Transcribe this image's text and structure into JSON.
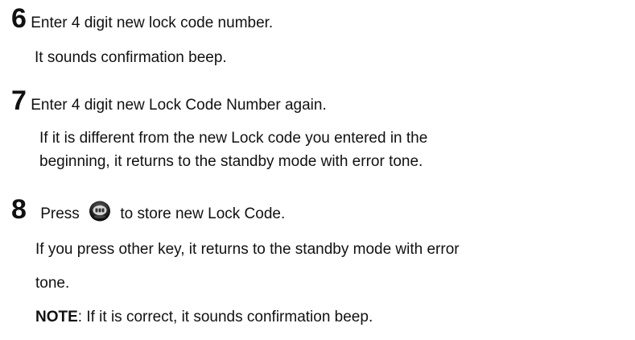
{
  "step6": {
    "number": "6",
    "instruction": "Enter 4 digit new lock code number.",
    "detail": "It sounds confirmation beep."
  },
  "step7": {
    "number": "7",
    "instruction": "Enter 4 digit new Lock Code Number again.",
    "detail_line1": "If it is different from the new Lock code you entered in the",
    "detail_line2": "beginning, it returns to the standby mode with error tone."
  },
  "step8": {
    "number": "8",
    "press_word": "Press",
    "button_icon": "ok-key-icon",
    "instruction_rest": "to store new Lock Code.",
    "detail_line1": "If you press other key, it returns to the standby mode with error",
    "detail_line2": "tone."
  },
  "note": {
    "label": "NOTE",
    "text": ": If it is correct, it sounds confirmation beep."
  }
}
